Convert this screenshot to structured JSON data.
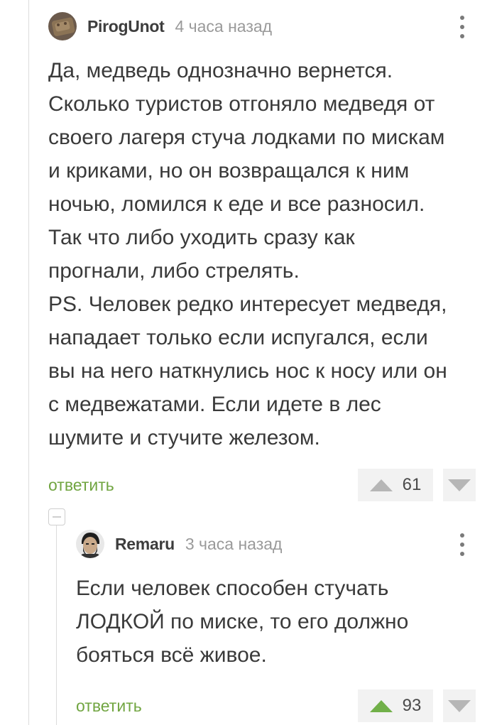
{
  "comments": [
    {
      "author": "PirogUnot",
      "time": "4 часа назад",
      "text": "Да, медведь однозначно вернется.\nСколько туристов отгоняло медведя от\nсвоего лагеря стуча лодками по мискам\nи криками, но он возвращался к ним\nночью, ломился к еде и все разносил.\nТак что либо уходить сразу как\nпрогнали, либо стрелять.\nPS. Человек редко интересует медведя,\nнападает только если испугался, если\nвы на него наткнулись нос к носу или он\nс медвежатами. Если идете в лес\nшумите и стучите железом.",
      "reply_label": "ответить",
      "rating": "61",
      "vote_state": "none"
    },
    {
      "author": "Remaru",
      "time": "3 часа назад",
      "text": "Если человек способен стучать\nЛОДКОЙ по миске, то его должно\nбояться всё живое.",
      "reply_label": "ответить",
      "rating": "93",
      "vote_state": "upvoted"
    }
  ],
  "colors": {
    "accent_green": "#71a541",
    "upvote_active": "#71b049",
    "muted": "#9a9a9a"
  },
  "icons": {
    "more": "more-vertical-icon",
    "collapse": "collapse-minus-icon",
    "upvote": "upvote-triangle-icon",
    "downvote": "downvote-triangle-icon"
  }
}
